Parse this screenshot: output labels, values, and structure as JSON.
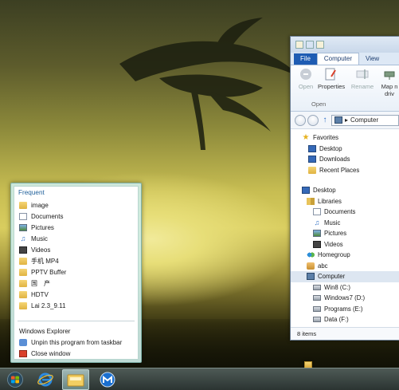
{
  "explorer": {
    "tabs": [
      "File",
      "Computer",
      "View"
    ],
    "ribbon": {
      "open_label": "Open",
      "properties_label": "Properties",
      "rename_label": "Rename",
      "map_label": "Map n",
      "map_label2": "driv",
      "group_label": "Open"
    },
    "address_text": "Computer",
    "nav": {
      "favorites": "Favorites",
      "desktop_fav": "Desktop",
      "downloads": "Downloads",
      "recent": "Recent Places",
      "desktop": "Desktop",
      "libraries": "Libraries",
      "documents": "Documents",
      "music": "Music",
      "pictures": "Pictures",
      "videos": "Videos",
      "homegroup": "Homegroup",
      "abc": "abc",
      "computer": "Computer",
      "drive_c": "Win8 (C:)",
      "drive_d": "Windows7 (D:)",
      "drive_e": "Programs (E:)",
      "drive_f": "Data (F:)"
    },
    "status": "8 items"
  },
  "jumplist": {
    "header": "Frequent",
    "items": [
      {
        "label": "image",
        "icon": "folder-icon"
      },
      {
        "label": "Documents",
        "icon": "documents-icon"
      },
      {
        "label": "Pictures",
        "icon": "pictures-icon"
      },
      {
        "label": "Music",
        "icon": "music-icon"
      },
      {
        "label": "Videos",
        "icon": "videos-icon"
      },
      {
        "label": "手机 MP4",
        "icon": "folder-icon"
      },
      {
        "label": "PPTV Buffer",
        "icon": "folder-icon"
      },
      {
        "label": "国　产",
        "icon": "folder-icon"
      },
      {
        "label": "HDTV",
        "icon": "folder-icon"
      },
      {
        "label": "Lai 2.3_9.11",
        "icon": "folder-icon"
      }
    ],
    "tasks": {
      "explorer": "Windows Explorer",
      "unpin": "Unpin this program from taskbar",
      "close": "Close window"
    }
  },
  "taskbar": {
    "icons": [
      "start-orb-icon",
      "internet-explorer-icon",
      "file-explorer-icon",
      "maxthon-icon"
    ]
  }
}
